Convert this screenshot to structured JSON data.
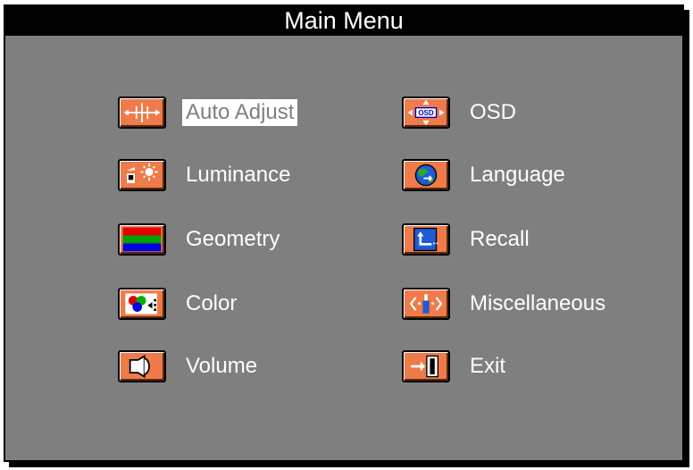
{
  "title": "Main Menu",
  "colors": {
    "panel": "#7f7f7f",
    "icon_bg": "#ef7a4a",
    "text": "#ffffff",
    "title_bar": "#000000"
  },
  "left_column": [
    {
      "label": "Auto Adjust",
      "icon": "auto-adjust-icon",
      "selected": true
    },
    {
      "label": "Luminance",
      "icon": "luminance-icon"
    },
    {
      "label": "Geometry",
      "icon": "geometry-icon"
    },
    {
      "label": "Color",
      "icon": "color-icon"
    },
    {
      "label": "Volume",
      "icon": "volume-icon"
    }
  ],
  "right_column": [
    {
      "label": "OSD",
      "icon": "osd-icon"
    },
    {
      "label": "Language",
      "icon": "language-icon"
    },
    {
      "label": "Recall",
      "icon": "recall-icon"
    },
    {
      "label": "Miscellaneous",
      "icon": "miscellaneous-icon"
    },
    {
      "label": "Exit",
      "icon": "exit-icon"
    }
  ],
  "icon_text": {
    "osd": "OSD"
  }
}
